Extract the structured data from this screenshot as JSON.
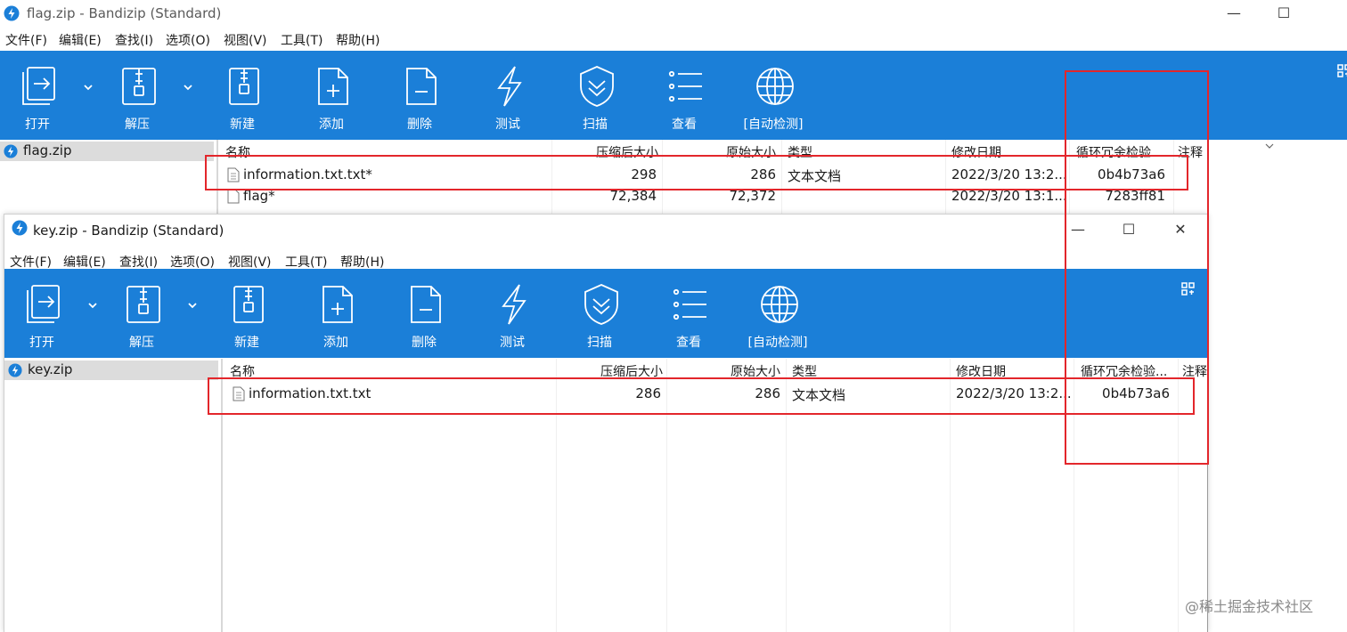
{
  "back_window": {
    "title": "flag.zip - Bandizip (Standard)",
    "menu": [
      "文件(F)",
      "编辑(E)",
      "查找(I)",
      "选项(O)",
      "视图(V)",
      "工具(T)",
      "帮助(H)"
    ],
    "toolbar": [
      "打开",
      "解压",
      "新建",
      "添加",
      "删除",
      "测试",
      "扫描",
      "查看",
      "[自动检测]"
    ],
    "tree_item": "flag.zip",
    "columns": [
      "名称",
      "压缩后大小",
      "原始大小",
      "类型",
      "修改日期",
      "循环冗余检验...",
      "注释"
    ],
    "rows": [
      {
        "name": "information.txt.txt*",
        "packed": "298",
        "size": "286",
        "type": "文本文档",
        "modified": "2022/3/20 13:2...",
        "crc": "0b4b73a6"
      },
      {
        "name": "flag*",
        "packed": "72,384",
        "size": "72,372",
        "type": "",
        "modified": "2022/3/20 13:1...",
        "crc": "7283ff81"
      }
    ]
  },
  "front_window": {
    "title": "key.zip - Bandizip (Standard)",
    "menu": [
      "文件(F)",
      "编辑(E)",
      "查找(I)",
      "选项(O)",
      "视图(V)",
      "工具(T)",
      "帮助(H)"
    ],
    "toolbar": [
      "打开",
      "解压",
      "新建",
      "添加",
      "删除",
      "测试",
      "扫描",
      "查看",
      "[自动检测]"
    ],
    "tree_item": "key.zip",
    "columns": [
      "名称",
      "压缩后大小",
      "原始大小",
      "类型",
      "修改日期",
      "循环冗余检验...",
      "注释"
    ],
    "rows": [
      {
        "name": "information.txt.txt",
        "packed": "286",
        "size": "286",
        "type": "文本文档",
        "modified": "2022/3/20 13:2...",
        "crc": "0b4b73a6"
      }
    ]
  },
  "watermark": "@稀土掘金技术社区",
  "colors": {
    "toolbar": "#1b7fd8",
    "highlight": "#e3262b"
  }
}
